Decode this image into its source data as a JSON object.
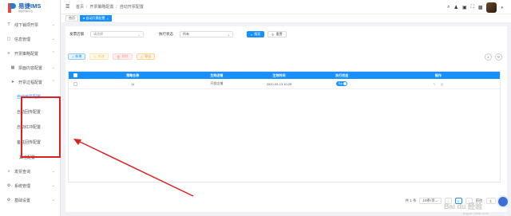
{
  "logo": {
    "title": "易捷IMS",
    "subtitle": "易捷开票平台"
  },
  "sidebar": {
    "items": [
      {
        "label": "线下销项开票",
        "icon": "T"
      },
      {
        "label": "信息管理",
        "icon": "▢"
      },
      {
        "label": "开票策略配置",
        "icon": "≡"
      }
    ],
    "sub1": {
      "label": "票面内容配置"
    },
    "sub2": {
      "label": "开票过程配置"
    },
    "sub3_items": [
      {
        "label": "自动开票配置"
      },
      {
        "label": "自动回传配置"
      },
      {
        "label": "自动红冲配置"
      },
      {
        "label": "备注回传配置"
      }
    ],
    "other": {
      "label": "其他配置"
    },
    "bottom": [
      {
        "label": "发票查询"
      },
      {
        "label": "系统管理"
      },
      {
        "label": "基础设置"
      }
    ]
  },
  "header": {
    "breadcrumb": [
      "首页",
      "开票策略配置",
      "自动开票配置"
    ]
  },
  "tabs": [
    {
      "label": "首页"
    },
    {
      "label": "● 自动开票配置",
      "close": "×"
    }
  ],
  "filters": {
    "store_label": "发票店铺",
    "store_placeholder": "请选择",
    "status_label": "执行状态",
    "status_value": "所有",
    "search_label": "搜索",
    "reset_label": "重置"
  },
  "actions": {
    "add": "新增",
    "edit": "修改",
    "delete": "删除",
    "export": "导出"
  },
  "table": {
    "headers": [
      "策略名称",
      "生效店铺",
      "生效时间",
      "执行状态",
      "操作"
    ],
    "rows": [
      {
        "name": "11",
        "store": "开发店铺",
        "time": "2020-03-13 10:28",
        "status": "开启"
      }
    ]
  },
  "pagination": {
    "total": "共 1 条",
    "page_size": "10条/页",
    "page": "1",
    "goto_label": "前往",
    "goto_value": "1",
    "goto_suffix": "页"
  },
  "watermark": {
    "main": "Bai du 经验",
    "sub": "jingyan.baidu.com"
  },
  "colors": {
    "primary": "#1890ff",
    "annotation": "#e02020"
  }
}
